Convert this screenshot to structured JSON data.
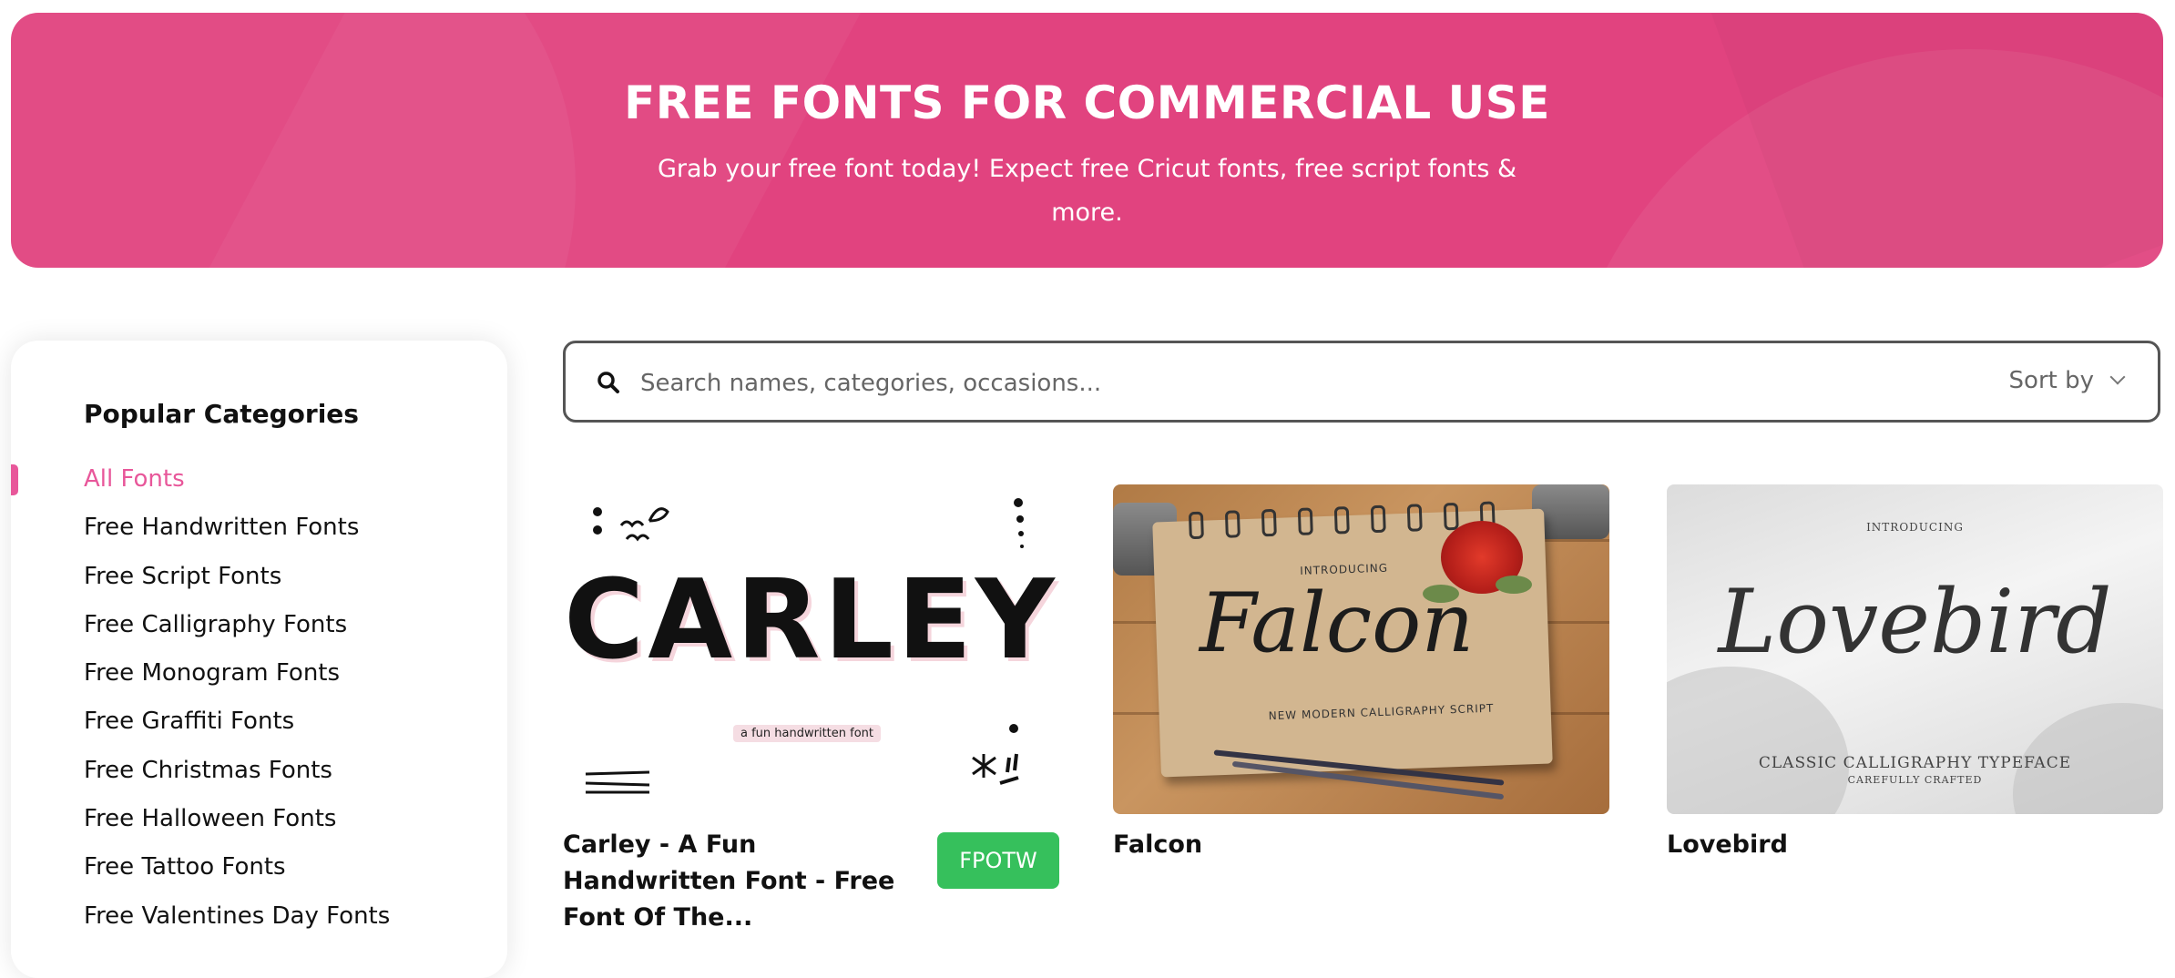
{
  "banner": {
    "title": "FREE FONTS FOR COMMERCIAL USE",
    "subtitle": "Grab your free font today! Expect free Cricut fonts, free script fonts & more."
  },
  "sidebar": {
    "title": "Popular Categories",
    "items": [
      {
        "label": "All Fonts",
        "active": true
      },
      {
        "label": "Free Handwritten Fonts",
        "active": false
      },
      {
        "label": "Free Script Fonts",
        "active": false
      },
      {
        "label": "Free Calligraphy Fonts",
        "active": false
      },
      {
        "label": "Free Monogram Fonts",
        "active": false
      },
      {
        "label": "Free Graffiti Fonts",
        "active": false
      },
      {
        "label": "Free Christmas Fonts",
        "active": false
      },
      {
        "label": "Free Halloween Fonts",
        "active": false
      },
      {
        "label": "Free Tattoo Fonts",
        "active": false
      },
      {
        "label": "Free Valentines Day Fonts",
        "active": false
      }
    ]
  },
  "search": {
    "placeholder": "Search names, categories, occasions...",
    "value": "",
    "sort_label": "Sort by",
    "icon": "search-icon"
  },
  "cards": [
    {
      "title": "Carley - A Fun Handwritten Font - Free Font Of The...",
      "badge": "FPOTW",
      "image": {
        "headline": "CARLEY",
        "tagline": "a fun handwritten font"
      }
    },
    {
      "title": "Falcon",
      "image": {
        "headline": "Falcon",
        "top_text": "INTRODUCING",
        "bottom_text": "NEW MODERN CALLIGRAPHY SCRIPT"
      }
    },
    {
      "title": "Lovebird",
      "image": {
        "headline": "Lovebird",
        "top_text": "INTRODUCING",
        "line1": "CLASSIC CALLIGRAPHY TYPEFACE",
        "line2": "CAREFULLY CRAFTED"
      }
    }
  ],
  "colors": {
    "banner": "#e1437f",
    "accent": "#e8579a",
    "badge": "#36c05c"
  }
}
